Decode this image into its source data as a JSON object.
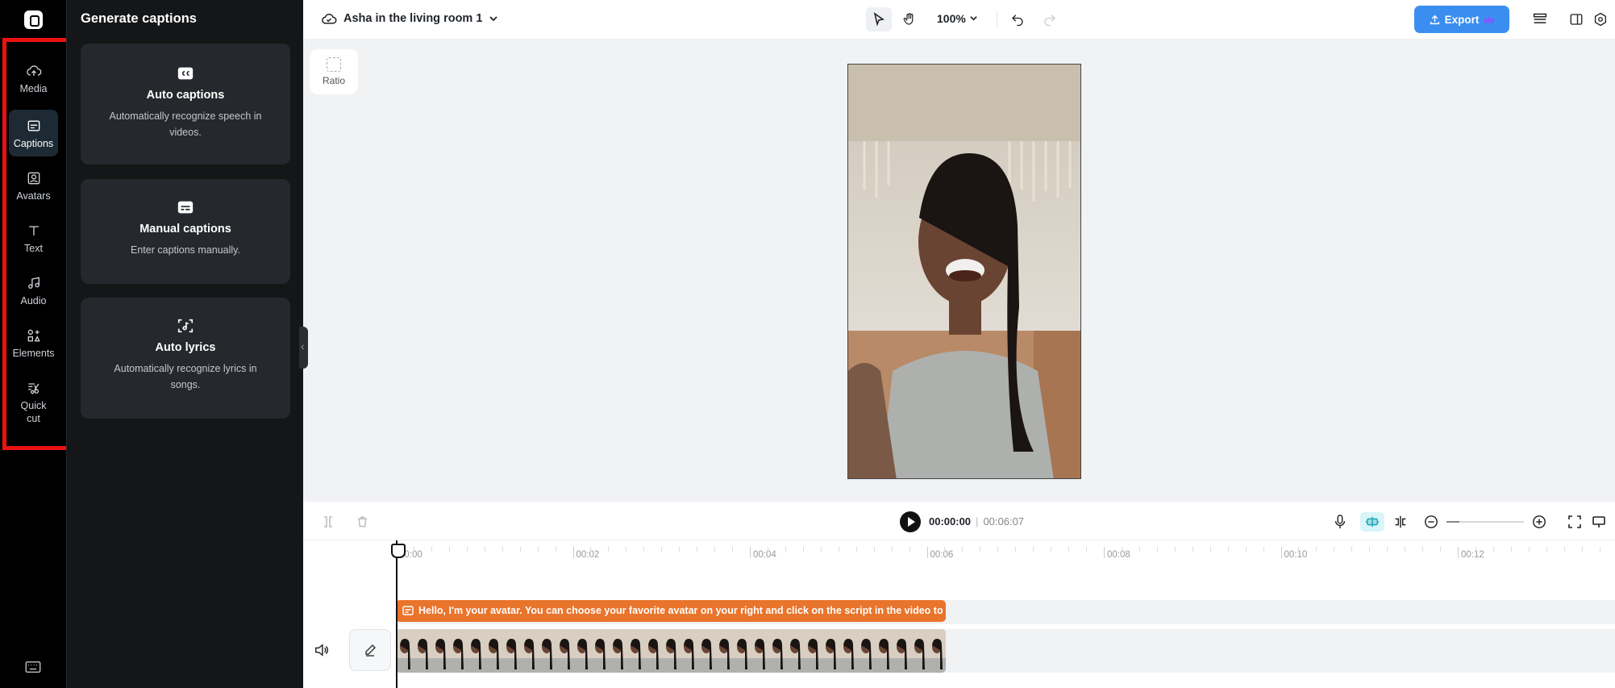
{
  "rail": {
    "items": [
      {
        "label": "Media",
        "icon": "cloud-upload-icon"
      },
      {
        "label": "Captions",
        "icon": "captions-icon"
      },
      {
        "label": "Avatars",
        "icon": "avatar-icon"
      },
      {
        "label": "Text",
        "icon": "text-icon"
      },
      {
        "label": "Audio",
        "icon": "music-note-icon"
      },
      {
        "label": "Elements",
        "icon": "elements-icon"
      },
      {
        "label": "Quick",
        "label2": "cut",
        "icon": "scissors-icon"
      }
    ],
    "active": "Captions"
  },
  "panel": {
    "title": "Generate captions",
    "cards": [
      {
        "title": "Auto captions",
        "desc": "Automatically recognize speech in videos.",
        "icon": "cc-icon"
      },
      {
        "title": "Manual captions",
        "desc": "Enter captions manually.",
        "icon": "keyboard-caption-icon"
      },
      {
        "title": "Auto lyrics",
        "desc": "Automatically recognize lyrics in songs.",
        "icon": "lyrics-scan-icon"
      }
    ]
  },
  "topbar": {
    "project_name": "Asha in the living room 1",
    "zoom": "100%",
    "export_label": "Export"
  },
  "canvas": {
    "ratio_label": "Ratio"
  },
  "timeline": {
    "current_time": "00:00:00",
    "separator": "|",
    "duration": "00:06:07",
    "ruler": [
      "00:00",
      "00:02",
      "00:04",
      "00:06",
      "00:08",
      "00:10",
      "00:12"
    ],
    "caption_text": "Hello, I'm your avatar. You can choose your favorite avatar on your right and click on the script in the video to ec",
    "zoom_level": 0.17
  },
  "colors": {
    "accent": "#3b8ef0",
    "caption_clip": "#e9742b",
    "highlight": "#ee1111"
  }
}
